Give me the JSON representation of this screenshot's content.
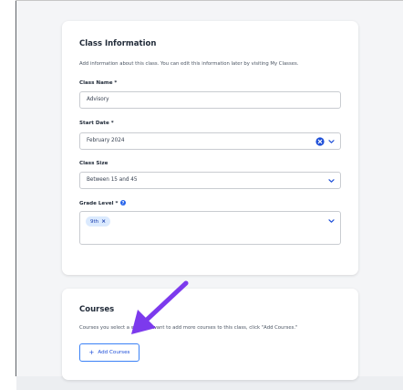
{
  "colors": {
    "accent": "#2563eb",
    "annotation_arrow": "#7c3aed",
    "chip_bg": "#dbeafe"
  },
  "class_info": {
    "title": "Class Information",
    "description": "Add information about this class. You can edit this information later by visiting My Classes.",
    "class_name": {
      "label": "Class Name *",
      "value": "Advisory"
    },
    "start_date": {
      "label": "Start Date *",
      "value": "February 2024",
      "clear_icon": "clear-circle-icon",
      "dropdown_icon": "chevron-down-icon"
    },
    "class_size": {
      "label": "Class Size",
      "value": "Between 15 and 45",
      "dropdown_icon": "chevron-down-icon"
    },
    "grade_level": {
      "label": "Grade Level *",
      "help_icon": "help-circle-icon",
      "chips": [
        {
          "label": "9th",
          "remove_icon": "close-icon"
        }
      ],
      "dropdown_icon": "chevron-down-icon"
    }
  },
  "courses": {
    "title": "Courses",
    "description": "Courses you select a w. If you want to add more courses to this class, click \"Add Courses.\"",
    "add_button": {
      "icon": "plus-icon",
      "label": "Add Courses"
    }
  },
  "annotation": {
    "icon": "arrow-annotation-icon"
  }
}
